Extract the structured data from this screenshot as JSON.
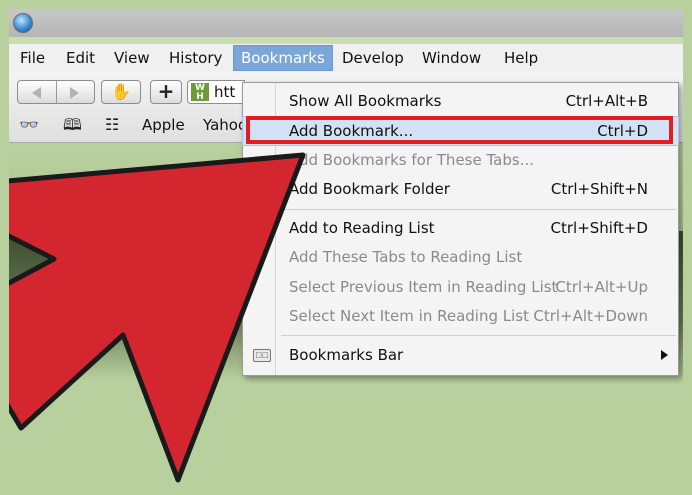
{
  "menubar": {
    "items": [
      "File",
      "Edit",
      "View",
      "History",
      "Bookmarks",
      "Develop",
      "Window",
      "Help"
    ],
    "active": "Bookmarks"
  },
  "toolbar": {
    "url_partial": "htt",
    "favicon_letters": "W H",
    "bookmarks_bar": [
      "Apple",
      "Yahoo"
    ]
  },
  "dropdown": {
    "items": [
      {
        "label": "Show All Bookmarks",
        "shortcut": "Ctrl+Alt+B",
        "disabled": false
      },
      {
        "label": "Add Bookmark...",
        "shortcut": "Ctrl+D",
        "disabled": false,
        "highlighted": true
      },
      {
        "label": "Add Bookmarks for These Tabs...",
        "shortcut": "",
        "disabled": true
      },
      {
        "label": "Add Bookmark Folder",
        "shortcut": "Ctrl+Shift+N",
        "disabled": false
      },
      {
        "label": "Add to Reading List",
        "shortcut": "Ctrl+Shift+D",
        "disabled": false
      },
      {
        "label": "Add These Tabs to Reading List",
        "shortcut": "",
        "disabled": true
      },
      {
        "label": "Select Previous Item in Reading List",
        "shortcut": "Ctrl+Alt+Up",
        "disabled": true
      },
      {
        "label": "Select Next Item in Reading List",
        "shortcut": "Ctrl+Alt+Down",
        "disabled": true
      },
      {
        "label": "Bookmarks Bar",
        "shortcut": "",
        "disabled": false,
        "submenu": true
      }
    ]
  },
  "colors": {
    "highlight_box": "#e11d23",
    "arrow_fill": "#d4262e",
    "menu_active": "#7aa6d8",
    "background": "#b8d09e"
  },
  "icons": {
    "app": "safari-app-icon",
    "nav_back": "back-arrow-icon",
    "nav_forward": "forward-arrow-icon",
    "hand": "hand-stop-icon",
    "plus": "plus-icon",
    "reader": "glasses-icon",
    "book": "book-icon",
    "grid": "grid-icon",
    "bookmarks_bar": "bookmarks-bar-icon",
    "submenu": "chevron-right-icon",
    "pointer": "red-arrow-pointer"
  }
}
